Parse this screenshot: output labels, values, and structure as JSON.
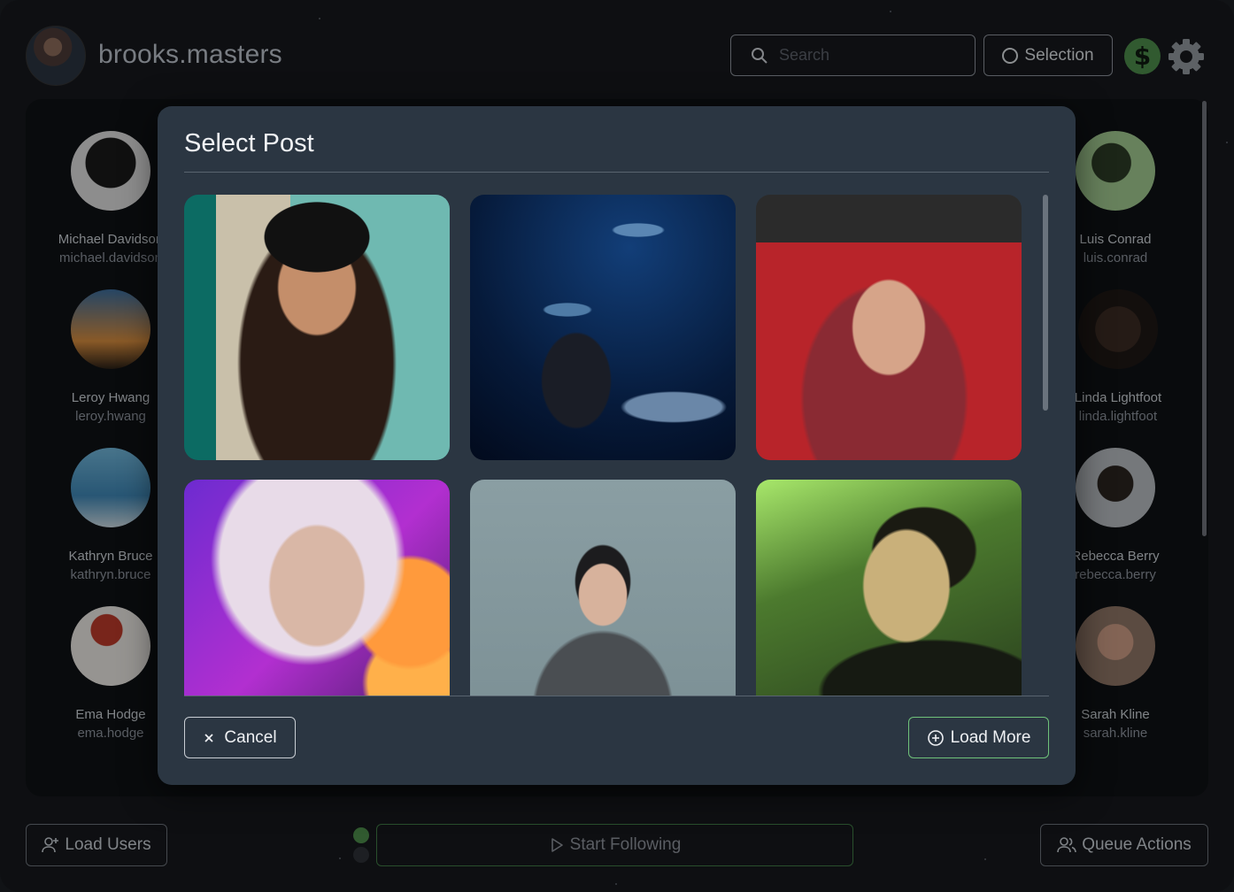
{
  "header": {
    "username": "brooks.masters",
    "search_placeholder": "Search",
    "selection_label": "Selection",
    "dollar_symbol": "$"
  },
  "users_left": [
    {
      "name": "Michael Davidson",
      "handle": "michael.davidson"
    },
    {
      "name": "Leroy Hwang",
      "handle": "leroy.hwang"
    },
    {
      "name": "Kathryn Bruce",
      "handle": "kathryn.bruce"
    },
    {
      "name": "Ema Hodge",
      "handle": "ema.hodge"
    }
  ],
  "users_right": [
    {
      "name": "Luis Conrad",
      "handle": "luis.conrad"
    },
    {
      "name": "Linda Lightfoot",
      "handle": "linda.lightfoot"
    },
    {
      "name": "Rebecca Berry",
      "handle": "rebecca.berry"
    },
    {
      "name": "Sarah Kline",
      "handle": "sarah.kline"
    }
  ],
  "modal": {
    "title": "Select Post",
    "cancel_label": "Cancel",
    "load_more_label": "Load More",
    "posts": [
      {
        "desc": "woman-black-hat"
      },
      {
        "desc": "aquarium-girl"
      },
      {
        "desc": "red-door-scarf"
      },
      {
        "desc": "neon-blonde"
      },
      {
        "desc": "sunglasses-wall"
      },
      {
        "desc": "green-light-man"
      }
    ]
  },
  "bottom": {
    "load_users_label": "Load Users",
    "start_following_label": "Start Following",
    "queue_actions_label": "Queue Actions"
  },
  "colors": {
    "accent_green": "#4c8a4a",
    "modal_bg": "#2b3642",
    "app_bg": "#16181c"
  }
}
